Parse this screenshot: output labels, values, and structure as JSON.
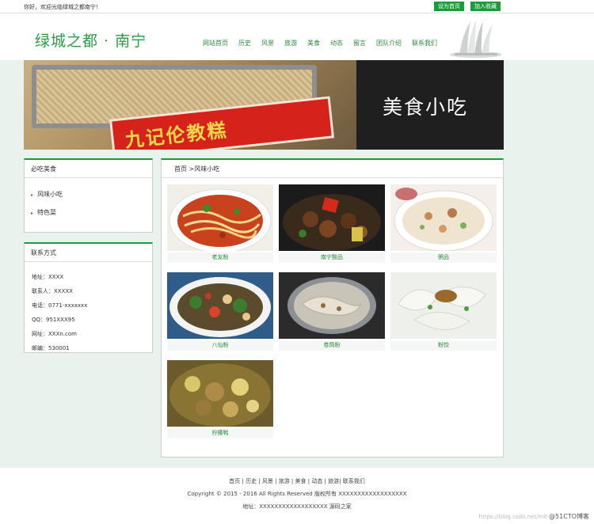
{
  "topbar": {
    "welcome": "你好，欢迎光临绿城之都南宁！",
    "set_home": "设为首页",
    "favorite": "加入收藏"
  },
  "header": {
    "logo": "绿城之都 · 南宁",
    "nav": [
      "网站首页",
      "历史",
      "风景",
      "旅游",
      "美食",
      "动态",
      "留言",
      "团队介绍",
      "联系我们"
    ]
  },
  "banner": {
    "title": "美食小吃",
    "sign_text": "九记伦教糕"
  },
  "sidebar": {
    "menu_title": "必吃美食",
    "menu_items": [
      "风味小吃",
      "特色菜"
    ],
    "contact_title": "联系方式",
    "contact_rows": [
      "地址：XXXX",
      "联系人：XXXXX",
      "电话：0771-xxxxxxx",
      "QQ：951XXX95",
      "网址：XXXn.com",
      "邮编：530001"
    ]
  },
  "content": {
    "breadcrumb": "首页 >风味小吃",
    "foods": [
      {
        "name": "老友粉",
        "icon": "noodle-soup-photo"
      },
      {
        "name": "南宁酸品",
        "icon": "braised-dish-photo"
      },
      {
        "name": "粥品",
        "icon": "porridge-photo"
      },
      {
        "name": "八仙粉",
        "icon": "rice-noodle-photo"
      },
      {
        "name": "卷筒粉",
        "icon": "rolled-noodle-photo"
      },
      {
        "name": "粉饺",
        "icon": "dumpling-photo"
      },
      {
        "name": "柠檬鸭",
        "icon": "lemon-duck-photo"
      }
    ]
  },
  "footer": {
    "links": "首页 | 历史 | 风景 | 旅游 | 美食 | 动态 | 旅游| 联系我们",
    "copyright": "Copyright © 2015 - 2016 All Rights Reserved 版权所有 XXXXXXXXXXXXXXXXXX",
    "address": "地址：XXXXXXXXXXXXXXXXXX 源码之家",
    "watermark_url": "https://blog.csdn.net/m0",
    "watermark_brand": "@51CTO博客"
  },
  "colors": {
    "accent": "#1e9a3a",
    "page_bg": "#e9f2ec"
  }
}
